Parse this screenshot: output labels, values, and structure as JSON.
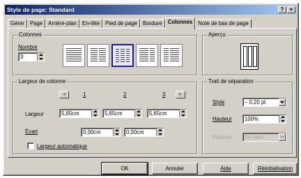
{
  "window": {
    "title": "Style de page: Standard",
    "help_glyph": "?",
    "close_glyph": "×"
  },
  "tabs": [
    {
      "label": "Gérer"
    },
    {
      "label": "Page"
    },
    {
      "label": "Arrière-plan"
    },
    {
      "label": "En-tête"
    },
    {
      "label": "Pied de page"
    },
    {
      "label": "Bordure"
    },
    {
      "label": "Colonnes",
      "active": true
    },
    {
      "label": "Note de bas de page"
    }
  ],
  "columns_group": {
    "title": "Colonnes",
    "number_label": "Nombre",
    "number_value": "3",
    "layouts": [
      "1 colonne",
      "2 colonnes",
      "3 colonnes",
      "2 colonnes (gauche large)",
      "2 colonnes (droite large)"
    ],
    "selected_layout": 2
  },
  "preview_group": {
    "title": "Aperçu",
    "columns": 3
  },
  "width_group": {
    "title": "Largeur de colonne",
    "col_numbers": [
      "1",
      "2",
      "3"
    ],
    "prev_glyph": "◄",
    "next_glyph": "►",
    "width_label": "Largeur",
    "widths": [
      "5,65cm",
      "5,65cm",
      "5,65cm"
    ],
    "spacing_label": "Écart",
    "spacings": [
      "0,00cm",
      "0,00cm"
    ],
    "auto_width_label": "Largeur automatique",
    "auto_width_checked": false
  },
  "separator_group": {
    "title": "Trait de séparation",
    "style_label": "Style",
    "style_value": "– 0,20 pt",
    "height_label": "Hauteur",
    "height_value": "100%",
    "position_label": "Position",
    "position_value": "En haut"
  },
  "buttons": {
    "ok": "OK",
    "cancel": "Annuler",
    "help": "Aide",
    "reset": "Réinitialisation"
  }
}
